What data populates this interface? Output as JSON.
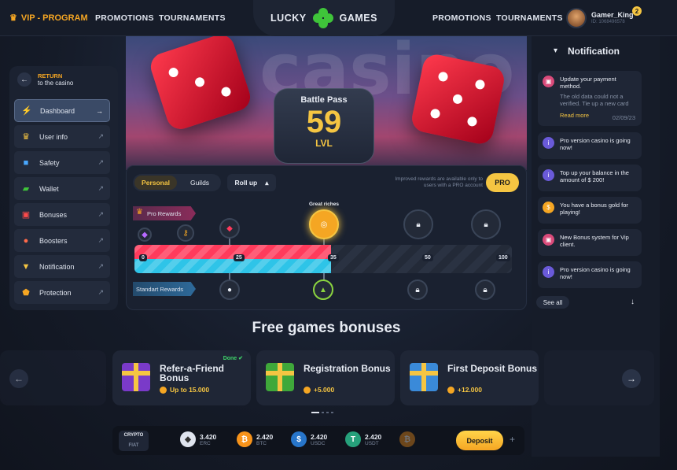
{
  "header": {
    "vip_label": "VIP - PROGRAM",
    "nav_left": [
      "PROMOTIONS",
      "TOURNAMENTS"
    ],
    "logo_left": "LUCKY",
    "logo_right": "GAMES",
    "nav_right": [
      "PROMOTIONS",
      "TOURNAMENTS"
    ],
    "user_name": "Gamer_King",
    "user_sub": "ID: 1068496578",
    "badge_count": "2"
  },
  "hero": {
    "bg_word": "casino",
    "battle_pass_title": "Battle Pass",
    "level": "59",
    "level_unit": "LVL"
  },
  "sidebar": {
    "back_line1": "RETURN",
    "back_line2": "to the casino",
    "items": [
      {
        "label": "Dashboard",
        "icon": "lightning-icon",
        "active": true
      },
      {
        "label": "User info",
        "icon": "crown-icon"
      },
      {
        "label": "Safety",
        "icon": "lock-icon"
      },
      {
        "label": "Wallet",
        "icon": "wallet-icon"
      },
      {
        "label": "Bonuses",
        "icon": "gift-icon"
      },
      {
        "label": "Boosters",
        "icon": "rocket-icon"
      },
      {
        "label": "Notification",
        "icon": "bell-icon"
      },
      {
        "label": "Protection",
        "icon": "shield-icon"
      }
    ]
  },
  "rewards": {
    "tabs": [
      "Personal",
      "Guilds"
    ],
    "active_tab": "Personal",
    "roll_label": "Roll up",
    "hint": "Improved rewards are available only to users with a PRO account",
    "pro_button": "PRO",
    "pro_rewards_label": "Pro Rewards",
    "standard_rewards_label": "Standart Rewards",
    "great_riches_label": "Great riches",
    "progress_ticks": [
      "0",
      "25",
      "35",
      "50",
      "100"
    ],
    "progress_value": 35
  },
  "free_games": {
    "title": "Free games bonuses",
    "cards": [
      {
        "title": "Refer-a-Friend Bonus",
        "amount": "Up to 15.000",
        "status": "Done"
      },
      {
        "title": "Registration Bonus",
        "amount": "+5.000"
      },
      {
        "title": "First Deposit Bonus",
        "amount": "+12.000"
      }
    ]
  },
  "wallet": {
    "crypto": "CRYPTO",
    "fiat": "FIAT",
    "currencies": [
      {
        "value": "3.420",
        "code": "ERC"
      },
      {
        "value": "2.420",
        "code": "BTC"
      },
      {
        "value": "2.420",
        "code": "USDC"
      },
      {
        "value": "2.420",
        "code": "USDT"
      }
    ],
    "deposit_label": "Deposit",
    "plus": "+"
  },
  "notifications": {
    "title": "Notification",
    "items": [
      {
        "title": "Update your payment method.",
        "sub": "The old data could not a verified. Tie up a new card",
        "more": "Read more",
        "date": "02/09/23",
        "icon": "gift-icon"
      },
      {
        "title": "Pro version casino is going now!",
        "icon": "info-icon"
      },
      {
        "title": "Top up your balance in the amount of $ 200!",
        "icon": "info-icon"
      },
      {
        "title": "You have a bonus gold for playing!",
        "icon": "dollar-icon"
      },
      {
        "title": "New Bonus system for Vip client.",
        "icon": "gift-icon"
      },
      {
        "title": "Pro version casino is going now!",
        "icon": "info-icon"
      }
    ],
    "see_all": "See all"
  }
}
